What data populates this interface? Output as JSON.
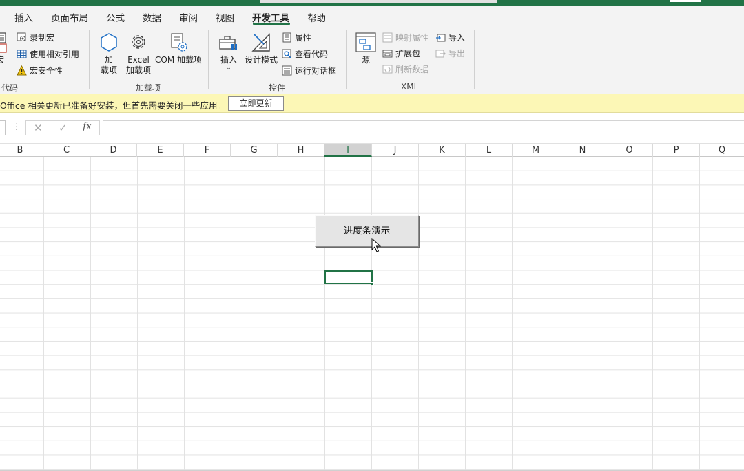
{
  "tabs": [
    {
      "label": "插入",
      "active": false
    },
    {
      "label": "页面布局",
      "active": false
    },
    {
      "label": "公式",
      "active": false
    },
    {
      "label": "数据",
      "active": false
    },
    {
      "label": "审阅",
      "active": false
    },
    {
      "label": "视图",
      "active": false
    },
    {
      "label": "开发工具",
      "active": true
    },
    {
      "label": "帮助",
      "active": false
    }
  ],
  "ribbon": {
    "code": {
      "macros_label_fragment": "宏",
      "record_macro": "录制宏",
      "relative_ref": "使用相对引用",
      "macro_security": "宏安全性",
      "group_label": "代码"
    },
    "addins": {
      "addins_line1": "加",
      "addins_line2": "载项",
      "excel_addins_line1": "Excel",
      "excel_addins_line2": "加载项",
      "com_addins": "COM 加载项",
      "group_label": "加载项"
    },
    "controls": {
      "insert": "插入",
      "design_mode": "设计模式",
      "properties": "属性",
      "view_code": "查看代码",
      "run_dialog": "运行对话框",
      "group_label": "控件"
    },
    "xml": {
      "source": "源",
      "map_properties": "映射属性",
      "expansion_packs": "扩展包",
      "refresh_data": "刷新数据",
      "import": "导入",
      "export": "导出",
      "group_label": "XML"
    }
  },
  "message_bar": {
    "text": "Office 相关更新已准备好安装，但首先需要关闭一些应用。",
    "button": "立即更新"
  },
  "formula_bar": {
    "fx": "fx",
    "value": ""
  },
  "columns": [
    "B",
    "C",
    "D",
    "E",
    "F",
    "G",
    "H",
    "I",
    "J",
    "K",
    "L",
    "M",
    "N",
    "O",
    "P",
    "Q"
  ],
  "selected_column": "I",
  "form_button": {
    "label": "进度条演示"
  },
  "colors": {
    "accent": "#217346",
    "message_bar": "#fcf7b6"
  }
}
